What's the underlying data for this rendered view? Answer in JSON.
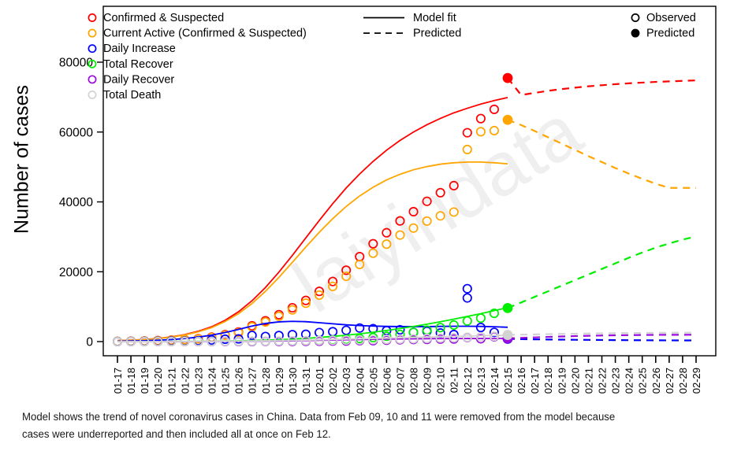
{
  "chart_data": {
    "type": "line",
    "title": "",
    "xlabel": "",
    "ylabel": "Number of cases",
    "ylim": [
      -3000,
      88000
    ],
    "yticks": [
      0,
      20000,
      40000,
      60000,
      80000
    ],
    "ytick_labels": [
      "0",
      "20000",
      "40000",
      "60000",
      "80000"
    ],
    "grid": false,
    "legend_position": "top",
    "x": [
      "01-17",
      "01-18",
      "01-19",
      "01-20",
      "01-21",
      "01-22",
      "01-23",
      "01-24",
      "01-25",
      "01-26",
      "01-27",
      "01-28",
      "01-29",
      "01-30",
      "01-31",
      "02-01",
      "02-02",
      "02-03",
      "02-04",
      "02-05",
      "02-06",
      "02-07",
      "02-08",
      "02-09",
      "02-10",
      "02-11",
      "02-12",
      "02-13",
      "02-14",
      "02-15",
      "02-16",
      "02-17",
      "02-18",
      "02-19",
      "02-20",
      "02-21",
      "02-22",
      "02-23",
      "02-24",
      "02-25",
      "02-26",
      "02-27",
      "02-28",
      "02-29"
    ],
    "observed_end_index": 28,
    "predicted_index": 29,
    "removed_dates": [
      "02-09",
      "02-10",
      "02-11"
    ],
    "series": [
      {
        "name": "Confirmed & Suspected",
        "color": "#FF0000",
        "observed": [
          62,
          121,
          198,
          291,
          440,
          571,
          830,
          1287,
          1975,
          2744,
          4515,
          5974,
          7711,
          9692,
          11791,
          14380,
          17205,
          20438,
          24324,
          28018,
          31161,
          34546,
          37198,
          40171,
          42638,
          44653,
          59804,
          63851,
          66492,
          null
        ],
        "fit": [
          300,
          420,
          600,
          900,
          1350,
          2000,
          2950,
          4250,
          6100,
          8550,
          11700,
          15500,
          19900,
          24700,
          29700,
          34700,
          39500,
          44000,
          48000,
          51600,
          54800,
          57600,
          60000,
          62100,
          63900,
          65500,
          66800,
          68000,
          69000,
          69900
        ],
        "predicted": [
          70600,
          71200,
          71800,
          72300,
          72700,
          73100,
          73400,
          73700,
          73950,
          74150,
          74350,
          74500,
          74650,
          74780
        ],
        "outliers": {
          "02-09": 37198,
          "02-10": 40171,
          "02-11": 42638
        },
        "predicted_point": 75465
      },
      {
        "name": "Current Active (Confirmed & Suspected)",
        "color": "#FFA500",
        "observed": [
          45,
          100,
          170,
          255,
          390,
          510,
          760,
          1180,
          1830,
          2560,
          4240,
          5600,
          7240,
          9080,
          11000,
          13300,
          15800,
          18700,
          22100,
          25300,
          27900,
          30500,
          32500,
          34500,
          36000,
          37100,
          55000,
          60100,
          60400,
          null
        ],
        "fit": [
          280,
          400,
          570,
          850,
          1280,
          1900,
          2800,
          4000,
          5750,
          8000,
          10900,
          14400,
          18400,
          22700,
          27100,
          31300,
          35200,
          38700,
          41700,
          44200,
          46300,
          47900,
          49200,
          50100,
          50800,
          51200,
          51400,
          51400,
          51200,
          50900
        ],
        "outliers": {
          "02-09": 32500,
          "02-10": 34500,
          "02-11": 36000
        },
        "predicted_point": 63500,
        "predicted": [
          62000,
          60300,
          58500,
          56700,
          54900,
          53100,
          51400,
          49700,
          48100,
          46600,
          45200,
          44000,
          44000,
          44000
        ]
      },
      {
        "name": "Daily Increase",
        "color": "#0000FF",
        "observed": [
          17,
          59,
          77,
          93,
          149,
          131,
          259,
          457,
          688,
          769,
          1771,
          1459,
          1737,
          1981,
          2099,
          2589,
          2825,
          3233,
          3886,
          3694,
          3143,
          3385,
          2652,
          2973,
          2467,
          2015,
          15151,
          4047,
          2641,
          null
        ],
        "fit": [
          120,
          180,
          260,
          390,
          580,
          870,
          1280,
          1850,
          2600,
          3500,
          4450,
          5200,
          5650,
          5800,
          5700,
          5400,
          5100,
          4800,
          4600,
          4450,
          4350,
          4300,
          4300,
          4300,
          4350,
          4400,
          4400,
          4350,
          4250,
          4100
        ],
        "spike": {
          "02-12": 12500
        },
        "predicted_point": 800,
        "predicted": [
          700,
          650,
          600,
          560,
          520,
          490,
          460,
          430,
          410,
          390,
          370,
          350,
          340,
          330
        ]
      },
      {
        "name": "Total Recover",
        "color": "#00EE00",
        "observed": [
          12,
          15,
          18,
          25,
          28,
          30,
          34,
          38,
          49,
          51,
          60,
          103,
          124,
          171,
          243,
          328,
          475,
          632,
          892,
          1153,
          1540,
          2050,
          2649,
          3281,
          3996,
          4740,
          5911,
          6723,
          8096,
          null
        ],
        "fit": [
          20,
          24,
          28,
          34,
          42,
          55,
          75,
          105,
          150,
          215,
          300,
          410,
          550,
          720,
          930,
          1180,
          1480,
          1830,
          2230,
          2680,
          3180,
          3740,
          4340,
          4990,
          5680,
          6420,
          7200,
          8010,
          8860,
          9740
        ],
        "predicted_point": 9600,
        "predicted": [
          11200,
          12800,
          14400,
          16000,
          17600,
          19200,
          20800,
          22400,
          24000,
          25500,
          26900,
          28100,
          29200,
          30100
        ]
      },
      {
        "name": "Daily Recover",
        "color": "#9A0CDC",
        "observed": [
          1,
          3,
          3,
          7,
          3,
          2,
          4,
          4,
          11,
          2,
          9,
          43,
          21,
          47,
          72,
          85,
          147,
          157,
          260,
          261,
          387,
          510,
          599,
          632,
          715,
          744,
          1171,
          812,
          1373,
          null
        ],
        "fit": [
          5,
          6,
          8,
          10,
          14,
          20,
          28,
          40,
          56,
          78,
          106,
          142,
          186,
          238,
          298,
          364,
          434,
          506,
          576,
          642,
          702,
          754,
          796,
          830,
          856,
          874,
          886,
          892,
          894,
          892
        ],
        "predicted_point": 900,
        "predicted": [
          1050,
          1200,
          1340,
          1460,
          1570,
          1660,
          1740,
          1800,
          1850,
          1890,
          1920,
          1940,
          1950,
          1960
        ]
      },
      {
        "name": "Total Death",
        "color": "#D3D3D3",
        "observed": [
          2,
          3,
          4,
          6,
          9,
          17,
          25,
          41,
          56,
          80,
          106,
          132,
          170,
          213,
          259,
          304,
          361,
          425,
          490,
          563,
          637,
          722,
          812,
          908,
          1016,
          1113,
          1259,
          1380,
          1523,
          null
        ],
        "fit": [
          5,
          8,
          12,
          18,
          26,
          38,
          54,
          76,
          104,
          140,
          184,
          236,
          296,
          364,
          440,
          522,
          610,
          702,
          798,
          896,
          996,
          1096,
          1196,
          1294,
          1390,
          1484,
          1574,
          1660,
          1742,
          1820
        ],
        "predicted_point": 1900,
        "predicted": [
          1980,
          2060,
          2130,
          2200,
          2260,
          2310,
          2360,
          2400,
          2440,
          2470,
          2500,
          2520,
          2540,
          2550
        ]
      }
    ]
  },
  "legend": {
    "series_entries": [
      {
        "label": "Confirmed & Suspected",
        "color": "#FF0000"
      },
      {
        "label": "Current Active (Confirmed & Suspected)",
        "color": "#FFA500"
      },
      {
        "label": "Daily Increase",
        "color": "#0000FF"
      },
      {
        "label": "Total Recover",
        "color": "#00EE00"
      },
      {
        "label": "Daily Recover",
        "color": "#9A0CDC"
      },
      {
        "label": "Total Death",
        "color": "#D3D3D3"
      }
    ],
    "line_entries": [
      {
        "label": "Model fit",
        "style": "solid"
      },
      {
        "label": "Predicted",
        "style": "dashed"
      }
    ],
    "point_entries": [
      {
        "label": "Observed",
        "style": "open"
      },
      {
        "label": "Predicted",
        "style": "filled"
      }
    ]
  },
  "watermark": {
    "text": "laiyindata",
    "color": "#efefef"
  },
  "caption": {
    "line1": "Model shows the trend of novel coronavirus cases in China. Data from Feb 09, 10 and 11 were removed from the model because",
    "line2": "cases were underreported and then included all at once on Feb 12."
  }
}
